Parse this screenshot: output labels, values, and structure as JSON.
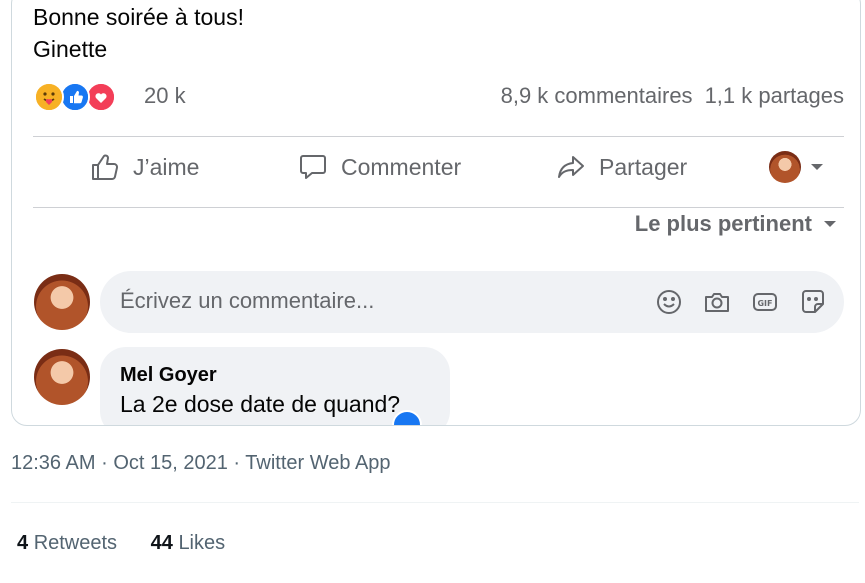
{
  "post": {
    "text_lines": [
      "Bonne soirée à tous!",
      "Ginette"
    ],
    "reaction_icons": [
      "care-reaction-icon",
      "like-reaction-icon",
      "love-reaction-icon"
    ],
    "reaction_count": "20 k",
    "comments_count": "8,9 k commentaires",
    "shares_count": "1,1 k partages"
  },
  "actions": {
    "like_label": "J’aime",
    "comment_label": "Commenter",
    "share_label": "Partager"
  },
  "sort": {
    "label": "Le plus pertinent"
  },
  "comment_input": {
    "placeholder": "Écrivez un commentaire..."
  },
  "comment": {
    "author": "Mel Goyer",
    "text": "La 2e dose date de quand?"
  },
  "tweet_meta": {
    "time": "12:36 AM",
    "date": "Oct 15, 2021",
    "source": "Twitter Web App",
    "separator": "·"
  },
  "engagement": {
    "retweets_count": "4",
    "retweets_label": "Retweets",
    "likes_count": "44",
    "likes_label": "Likes"
  },
  "colors": {
    "facebook_blue": "#1877f2",
    "love_red": "#f33e58",
    "care_yellow": "#f7b125",
    "secondary_text": "#65676b",
    "twitter_secondary": "#536471"
  }
}
